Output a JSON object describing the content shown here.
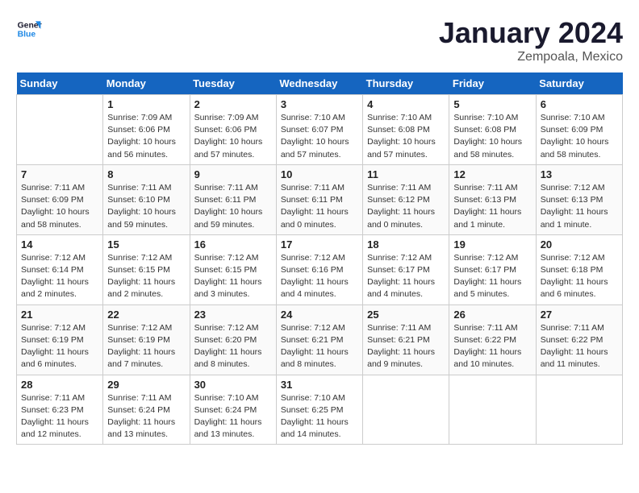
{
  "header": {
    "logo_line1": "General",
    "logo_line2": "Blue",
    "title": "January 2024",
    "subtitle": "Zempoala, Mexico"
  },
  "days_of_week": [
    "Sunday",
    "Monday",
    "Tuesday",
    "Wednesday",
    "Thursday",
    "Friday",
    "Saturday"
  ],
  "weeks": [
    [
      {
        "day": "",
        "info": ""
      },
      {
        "day": "1",
        "info": "Sunrise: 7:09 AM\nSunset: 6:06 PM\nDaylight: 10 hours\nand 56 minutes."
      },
      {
        "day": "2",
        "info": "Sunrise: 7:09 AM\nSunset: 6:06 PM\nDaylight: 10 hours\nand 57 minutes."
      },
      {
        "day": "3",
        "info": "Sunrise: 7:10 AM\nSunset: 6:07 PM\nDaylight: 10 hours\nand 57 minutes."
      },
      {
        "day": "4",
        "info": "Sunrise: 7:10 AM\nSunset: 6:08 PM\nDaylight: 10 hours\nand 57 minutes."
      },
      {
        "day": "5",
        "info": "Sunrise: 7:10 AM\nSunset: 6:08 PM\nDaylight: 10 hours\nand 58 minutes."
      },
      {
        "day": "6",
        "info": "Sunrise: 7:10 AM\nSunset: 6:09 PM\nDaylight: 10 hours\nand 58 minutes."
      }
    ],
    [
      {
        "day": "7",
        "info": "Sunrise: 7:11 AM\nSunset: 6:09 PM\nDaylight: 10 hours\nand 58 minutes."
      },
      {
        "day": "8",
        "info": "Sunrise: 7:11 AM\nSunset: 6:10 PM\nDaylight: 10 hours\nand 59 minutes."
      },
      {
        "day": "9",
        "info": "Sunrise: 7:11 AM\nSunset: 6:11 PM\nDaylight: 10 hours\nand 59 minutes."
      },
      {
        "day": "10",
        "info": "Sunrise: 7:11 AM\nSunset: 6:11 PM\nDaylight: 11 hours\nand 0 minutes."
      },
      {
        "day": "11",
        "info": "Sunrise: 7:11 AM\nSunset: 6:12 PM\nDaylight: 11 hours\nand 0 minutes."
      },
      {
        "day": "12",
        "info": "Sunrise: 7:11 AM\nSunset: 6:13 PM\nDaylight: 11 hours\nand 1 minute."
      },
      {
        "day": "13",
        "info": "Sunrise: 7:12 AM\nSunset: 6:13 PM\nDaylight: 11 hours\nand 1 minute."
      }
    ],
    [
      {
        "day": "14",
        "info": "Sunrise: 7:12 AM\nSunset: 6:14 PM\nDaylight: 11 hours\nand 2 minutes."
      },
      {
        "day": "15",
        "info": "Sunrise: 7:12 AM\nSunset: 6:15 PM\nDaylight: 11 hours\nand 2 minutes."
      },
      {
        "day": "16",
        "info": "Sunrise: 7:12 AM\nSunset: 6:15 PM\nDaylight: 11 hours\nand 3 minutes."
      },
      {
        "day": "17",
        "info": "Sunrise: 7:12 AM\nSunset: 6:16 PM\nDaylight: 11 hours\nand 4 minutes."
      },
      {
        "day": "18",
        "info": "Sunrise: 7:12 AM\nSunset: 6:17 PM\nDaylight: 11 hours\nand 4 minutes."
      },
      {
        "day": "19",
        "info": "Sunrise: 7:12 AM\nSunset: 6:17 PM\nDaylight: 11 hours\nand 5 minutes."
      },
      {
        "day": "20",
        "info": "Sunrise: 7:12 AM\nSunset: 6:18 PM\nDaylight: 11 hours\nand 6 minutes."
      }
    ],
    [
      {
        "day": "21",
        "info": "Sunrise: 7:12 AM\nSunset: 6:19 PM\nDaylight: 11 hours\nand 6 minutes."
      },
      {
        "day": "22",
        "info": "Sunrise: 7:12 AM\nSunset: 6:19 PM\nDaylight: 11 hours\nand 7 minutes."
      },
      {
        "day": "23",
        "info": "Sunrise: 7:12 AM\nSunset: 6:20 PM\nDaylight: 11 hours\nand 8 minutes."
      },
      {
        "day": "24",
        "info": "Sunrise: 7:12 AM\nSunset: 6:21 PM\nDaylight: 11 hours\nand 8 minutes."
      },
      {
        "day": "25",
        "info": "Sunrise: 7:11 AM\nSunset: 6:21 PM\nDaylight: 11 hours\nand 9 minutes."
      },
      {
        "day": "26",
        "info": "Sunrise: 7:11 AM\nSunset: 6:22 PM\nDaylight: 11 hours\nand 10 minutes."
      },
      {
        "day": "27",
        "info": "Sunrise: 7:11 AM\nSunset: 6:22 PM\nDaylight: 11 hours\nand 11 minutes."
      }
    ],
    [
      {
        "day": "28",
        "info": "Sunrise: 7:11 AM\nSunset: 6:23 PM\nDaylight: 11 hours\nand 12 minutes."
      },
      {
        "day": "29",
        "info": "Sunrise: 7:11 AM\nSunset: 6:24 PM\nDaylight: 11 hours\nand 13 minutes."
      },
      {
        "day": "30",
        "info": "Sunrise: 7:10 AM\nSunset: 6:24 PM\nDaylight: 11 hours\nand 13 minutes."
      },
      {
        "day": "31",
        "info": "Sunrise: 7:10 AM\nSunset: 6:25 PM\nDaylight: 11 hours\nand 14 minutes."
      },
      {
        "day": "",
        "info": ""
      },
      {
        "day": "",
        "info": ""
      },
      {
        "day": "",
        "info": ""
      }
    ]
  ]
}
